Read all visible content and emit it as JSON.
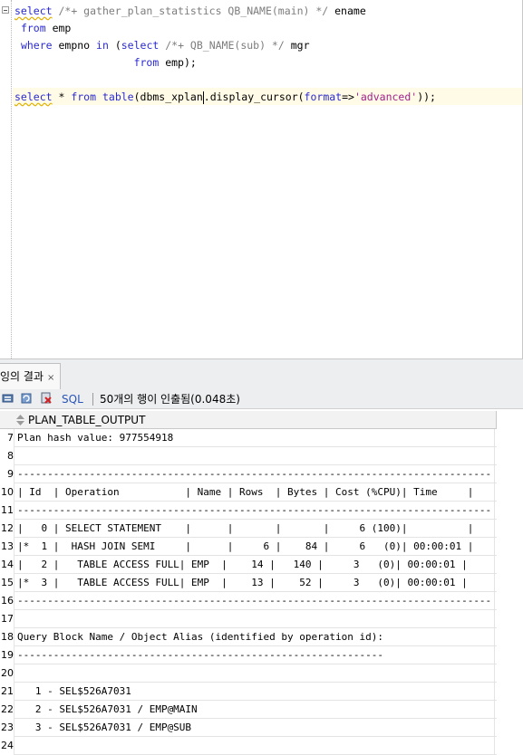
{
  "editor": {
    "lines": [
      {
        "tokens": [
          {
            "t": "select",
            "c": "kw sq"
          },
          {
            "t": " "
          },
          {
            "t": "/*+ gather_plan_statistics QB_NAME(main) */",
            "c": "cm"
          },
          {
            "t": " ename"
          }
        ]
      },
      {
        "tokens": [
          {
            "t": " "
          },
          {
            "t": "from",
            "c": "kw"
          },
          {
            "t": " emp"
          }
        ]
      },
      {
        "tokens": [
          {
            "t": " "
          },
          {
            "t": "where",
            "c": "kw"
          },
          {
            "t": " empno "
          },
          {
            "t": "in",
            "c": "kw"
          },
          {
            "t": " ("
          },
          {
            "t": "select",
            "c": "kw"
          },
          {
            "t": " "
          },
          {
            "t": "/*+ QB_NAME(sub) */",
            "c": "cm"
          },
          {
            "t": " mgr"
          }
        ]
      },
      {
        "tokens": [
          {
            "t": "                   "
          },
          {
            "t": "from",
            "c": "kw"
          },
          {
            "t": " emp);"
          }
        ]
      },
      {
        "tokens": [
          {
            "t": ""
          }
        ]
      },
      {
        "tokens": [
          {
            "t": "select",
            "c": "kw sq"
          },
          {
            "t": " * "
          },
          {
            "t": "from",
            "c": "kw"
          },
          {
            "t": " "
          },
          {
            "t": "table",
            "c": "kw"
          },
          {
            "t": "(dbms_xplan"
          },
          {
            "caret": true
          },
          {
            "t": ".display_cursor("
          },
          {
            "t": "format",
            "c": "kw"
          },
          {
            "t": "=>"
          },
          {
            "t": "'advanced'",
            "c": "st"
          },
          {
            "t": "));"
          }
        ]
      }
    ]
  },
  "result_tab": {
    "label": "잉의 결과",
    "close": "×"
  },
  "toolbar": {
    "sql_label": "SQL",
    "status": "50개의 행이 인출됨(0.048초)",
    "icons": [
      "pin-icon",
      "refresh-icon",
      "export-icon"
    ]
  },
  "grid": {
    "column": "PLAN_TABLE_OUTPUT",
    "rows": [
      {
        "n": "7",
        "text": "Plan hash value: 977554918"
      },
      {
        "n": "8",
        "text": ""
      },
      {
        "n": "9",
        "text": "-------------------------------------------------------------------------------"
      },
      {
        "n": "10",
        "text": "| Id  | Operation           | Name | Rows  | Bytes | Cost (%CPU)| Time     |"
      },
      {
        "n": "11",
        "text": "-------------------------------------------------------------------------------"
      },
      {
        "n": "12",
        "text": "|   0 | SELECT STATEMENT    |      |       |       |     6 (100)|          |"
      },
      {
        "n": "13",
        "text": "|*  1 |  HASH JOIN SEMI     |      |     6 |    84 |     6   (0)| 00:00:01 |"
      },
      {
        "n": "14",
        "text": "|   2 |   TABLE ACCESS FULL| EMP  |    14 |   140 |     3   (0)| 00:00:01 |"
      },
      {
        "n": "15",
        "text": "|*  3 |   TABLE ACCESS FULL| EMP  |    13 |    52 |     3   (0)| 00:00:01 |"
      },
      {
        "n": "16",
        "text": "-------------------------------------------------------------------------------"
      },
      {
        "n": "17",
        "text": ""
      },
      {
        "n": "18",
        "text": "Query Block Name / Object Alias (identified by operation id):"
      },
      {
        "n": "19",
        "text": "-------------------------------------------------------------"
      },
      {
        "n": "20",
        "text": ""
      },
      {
        "n": "21",
        "text": "   1 - SEL$526A7031"
      },
      {
        "n": "22",
        "text": "   2 - SEL$526A7031 / EMP@MAIN"
      },
      {
        "n": "23",
        "text": "   3 - SEL$526A7031 / EMP@SUB"
      },
      {
        "n": "24",
        "text": ""
      }
    ]
  }
}
